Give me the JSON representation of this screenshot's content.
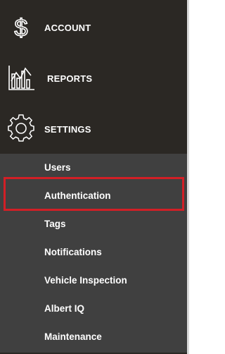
{
  "nav": {
    "account": {
      "label": "ACCOUNT",
      "icon": "dollar-sign-icon"
    },
    "reports": {
      "label": "REPORTS",
      "icon": "bar-chart-icon"
    },
    "settings": {
      "label": "SETTINGS",
      "icon": "gear-icon"
    }
  },
  "submenu": {
    "items": [
      {
        "label": "Users"
      },
      {
        "label": "Authentication",
        "selected": true
      },
      {
        "label": "Tags"
      },
      {
        "label": "Notifications"
      },
      {
        "label": "Vehicle Inspection"
      },
      {
        "label": "Albert IQ"
      },
      {
        "label": "Maintenance"
      }
    ]
  },
  "colors": {
    "sidebar_bg": "#2b2824",
    "submenu_bg": "#404040",
    "highlight": "#d21f26",
    "text": "#ffffff"
  }
}
